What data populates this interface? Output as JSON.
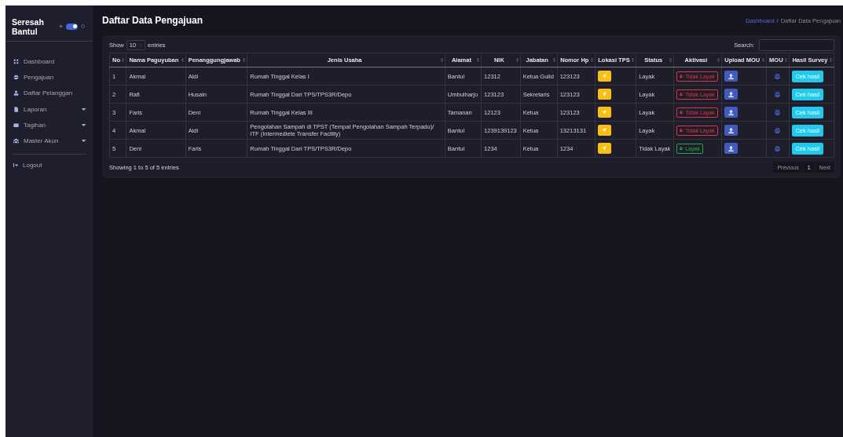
{
  "sidebar": {
    "brand": "Seresah Bantul",
    "theme_toggle": {
      "on": true
    },
    "items": [
      {
        "label": "Dashboard",
        "expandable": false
      },
      {
        "label": "Pengajuan",
        "expandable": false
      },
      {
        "label": "Daftar Pelanggan",
        "expandable": false
      },
      {
        "label": "Laporan",
        "expandable": true
      },
      {
        "label": "Tagihan",
        "expandable": true
      },
      {
        "label": "Master Akun",
        "expandable": true
      }
    ],
    "logout": "Logout"
  },
  "page": {
    "title": "Daftar Data Pengajuan",
    "breadcrumb": [
      "Dashboard",
      "Daftar Data Pengajuan"
    ],
    "breadcrumb_separator": "/"
  },
  "table_controls": {
    "show_label": "Show",
    "page_size": "10",
    "entries_label": "entries",
    "search_label": "Search:"
  },
  "table": {
    "columns": [
      "No",
      "Nama Paguyuban",
      "Penanggungjawab",
      "Jenis Usaha",
      "Alamat",
      "NIK",
      "Jabatan",
      "Nomor Hp",
      "Lokasi TPS",
      "Status",
      "Aktivasi",
      "Upload MOU",
      "MOU",
      "Hasil Survey"
    ],
    "rows": [
      {
        "no": "1",
        "nama": "Akmal",
        "pj": "Aldi",
        "jenis": "Rumah Tinggal Kelas I",
        "alamat": "Bantul",
        "nik": "12312",
        "jabatan": "Ketua Guild",
        "hp": "123123",
        "status": "Layak",
        "aktivasi": {
          "label": "Tidak Layak",
          "kind": "danger"
        },
        "hasil": "Cek hasil"
      },
      {
        "no": "2",
        "nama": "Rafi",
        "pj": "Husain",
        "jenis": "Rumah Tinggal Dari TPS/TPS3R/Depo",
        "alamat": "Umbulharjo",
        "nik": "123123",
        "jabatan": "Sekretaris",
        "hp": "123123",
        "status": "Layak",
        "aktivasi": {
          "label": "Tidak Layak",
          "kind": "danger"
        },
        "hasil": "Cek hasil"
      },
      {
        "no": "3",
        "nama": "Faris",
        "pj": "Deni",
        "jenis": "Rumah Tinggal Kelas III",
        "alamat": "Tamanan",
        "nik": "12123",
        "jabatan": "Ketua",
        "hp": "123123",
        "status": "Layak",
        "aktivasi": {
          "label": "Tidak Layak",
          "kind": "danger"
        },
        "hasil": "Cek hasil"
      },
      {
        "no": "4",
        "nama": "Akmal",
        "pj": "Aldi",
        "jenis": "Pengolahan Sampah di TPST (Tempat Pengolahan Sampah Terpadu)/ ITF (Intermediete Transfer Facility)",
        "alamat": "Bantul",
        "nik": "1239139123",
        "jabatan": "Ketua",
        "hp": "13213131",
        "status": "Layak",
        "aktivasi": {
          "label": "Tidak Layak",
          "kind": "danger"
        },
        "hasil": "Cek hasil"
      },
      {
        "no": "5",
        "nama": "Deni",
        "pj": "Faris",
        "jenis": "Rumah Tinggal Dari TPS/TPS3R/Depo",
        "alamat": "Bantul",
        "nik": "1234",
        "jabatan": "Ketua",
        "hp": "1234",
        "status": "Tidak Layak",
        "aktivasi": {
          "label": "Layak",
          "kind": "success"
        },
        "hasil": "Cek hasil"
      }
    ]
  },
  "info": "Showing 1 to 5 of 5 entries",
  "pagination": [
    {
      "label": "Previous",
      "selected": false
    },
    {
      "label": "1",
      "selected": true
    },
    {
      "label": "Next",
      "selected": false
    }
  ]
}
